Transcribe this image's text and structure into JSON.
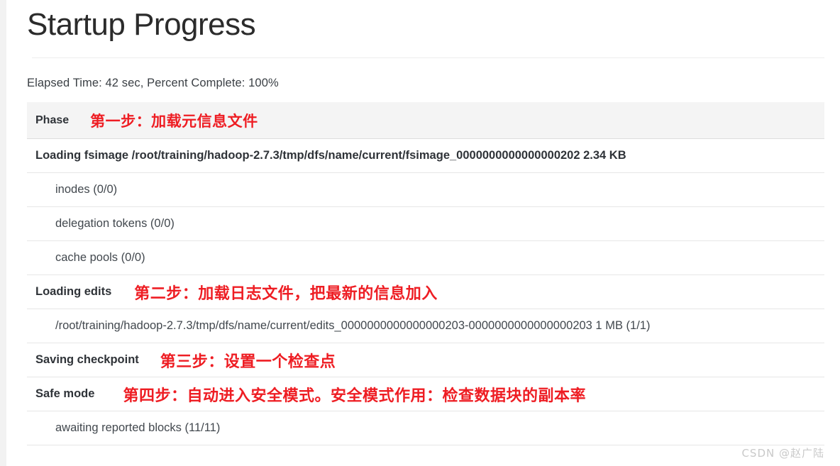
{
  "page": {
    "title": "Startup Progress",
    "elapsed_line": "Elapsed Time: 42 sec, Percent Complete: 100%",
    "elapsed_seconds": "42 sec",
    "percent_complete": "100%",
    "watermark": "CSDN @赵广陆",
    "accent_red": "#ee1d23",
    "header_bg": "#f4f4f4",
    "row_divider": "#e6e6e6"
  },
  "table": {
    "header": {
      "phase_label": "Phase"
    },
    "rows": [
      {
        "kind": "header",
        "label": "Phase",
        "annotation": "第一步：加载元信息文件"
      },
      {
        "kind": "phase",
        "label": "Loading fsimage /root/training/hadoop-2.7.3/tmp/dfs/name/current/fsimage_0000000000000000202 2.34 KB",
        "annotation": ""
      },
      {
        "kind": "step",
        "label": "inodes (0/0)",
        "annotation": ""
      },
      {
        "kind": "step",
        "label": "delegation tokens (0/0)",
        "annotation": ""
      },
      {
        "kind": "step",
        "label": "cache pools (0/0)",
        "annotation": ""
      },
      {
        "kind": "phase",
        "label": "Loading edits",
        "annotation": "第二步：加载日志文件，把最新的信息加入"
      },
      {
        "kind": "step",
        "label": "/root/training/hadoop-2.7.3/tmp/dfs/name/current/edits_0000000000000000203-0000000000000000203 1 MB (1/1)",
        "annotation": ""
      },
      {
        "kind": "phase",
        "label": "Saving checkpoint",
        "annotation": "第三步：设置一个检查点"
      },
      {
        "kind": "phase",
        "label": "Safe mode",
        "annotation": "第四步：自动进入安全模式。安全模式作用：检查数据块的副本率"
      },
      {
        "kind": "step",
        "label": "awaiting reported blocks (11/11)",
        "annotation": ""
      }
    ]
  }
}
